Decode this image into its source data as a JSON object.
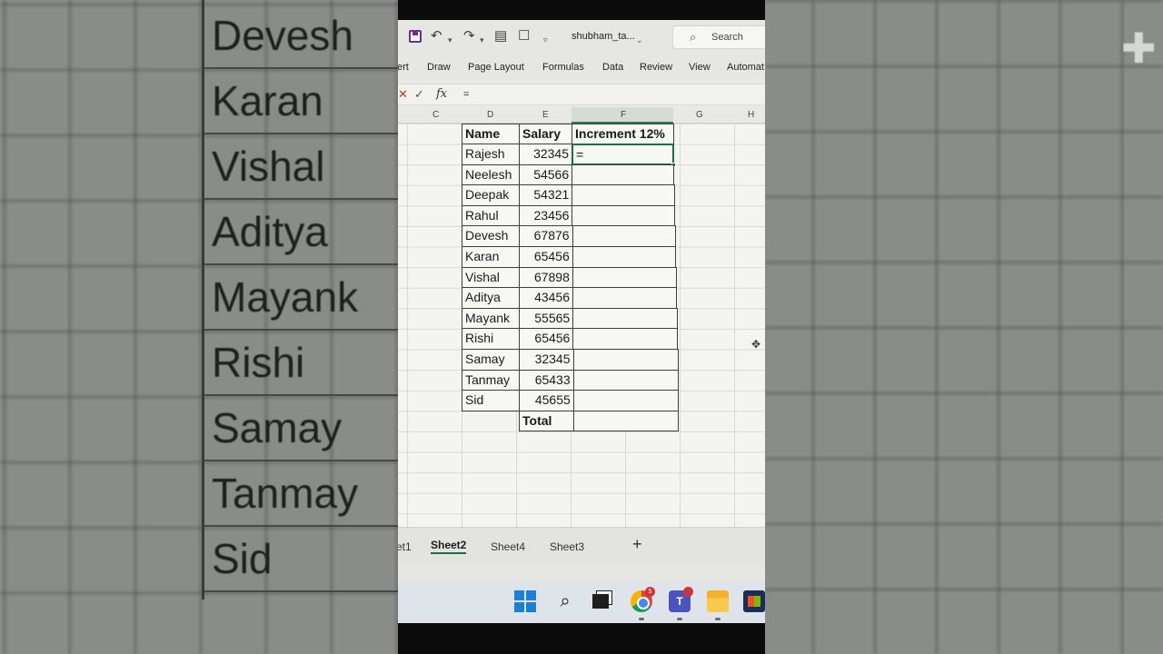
{
  "background": {
    "left_names": [
      "Devesh",
      "Karan",
      "Vishal",
      "Aditya",
      "Mayank",
      "Rishi",
      "Samay",
      "Tanmay",
      "Sid"
    ]
  },
  "title_bar": {
    "filename": "shubham_ta...",
    "search_placeholder": "Search"
  },
  "ribbon": {
    "tabs": [
      "ert",
      "Draw",
      "Page Layout",
      "Formulas",
      "Data",
      "Review",
      "View",
      "Automat"
    ]
  },
  "formula_bar": {
    "fx_label": "fx",
    "value": "="
  },
  "column_headers": [
    "C",
    "D",
    "E",
    "F",
    "G",
    "H"
  ],
  "table": {
    "headers": [
      "Name",
      "Salary",
      "Increment 12%"
    ],
    "rows": [
      {
        "name": "Rajesh",
        "salary": "32345",
        "increment": "="
      },
      {
        "name": "Neelesh",
        "salary": "54566",
        "increment": ""
      },
      {
        "name": "Deepak",
        "salary": "54321",
        "increment": ""
      },
      {
        "name": "Rahul",
        "salary": "23456",
        "increment": ""
      },
      {
        "name": "Devesh",
        "salary": "67876",
        "increment": ""
      },
      {
        "name": "Karan",
        "salary": "65456",
        "increment": ""
      },
      {
        "name": "Vishal",
        "salary": "67898",
        "increment": ""
      },
      {
        "name": "Aditya",
        "salary": "43456",
        "increment": ""
      },
      {
        "name": "Mayank",
        "salary": "55565",
        "increment": ""
      },
      {
        "name": "Rishi",
        "salary": "65456",
        "increment": ""
      },
      {
        "name": "Samay",
        "salary": "32345",
        "increment": ""
      },
      {
        "name": "Tanmay",
        "salary": "65433",
        "increment": ""
      },
      {
        "name": "Sid",
        "salary": "45655",
        "increment": ""
      }
    ],
    "total_label": "Total"
  },
  "sheet_tabs": {
    "tabs": [
      "et1",
      "Sheet2",
      "Sheet4",
      "Sheet3"
    ],
    "active": "Sheet2",
    "add_label": "+"
  },
  "taskbar": {
    "chrome_badge": "5",
    "teams_label": "T"
  },
  "colors": {
    "excel_green": "#1f6e43",
    "grid_line": "#d9dad6"
  }
}
